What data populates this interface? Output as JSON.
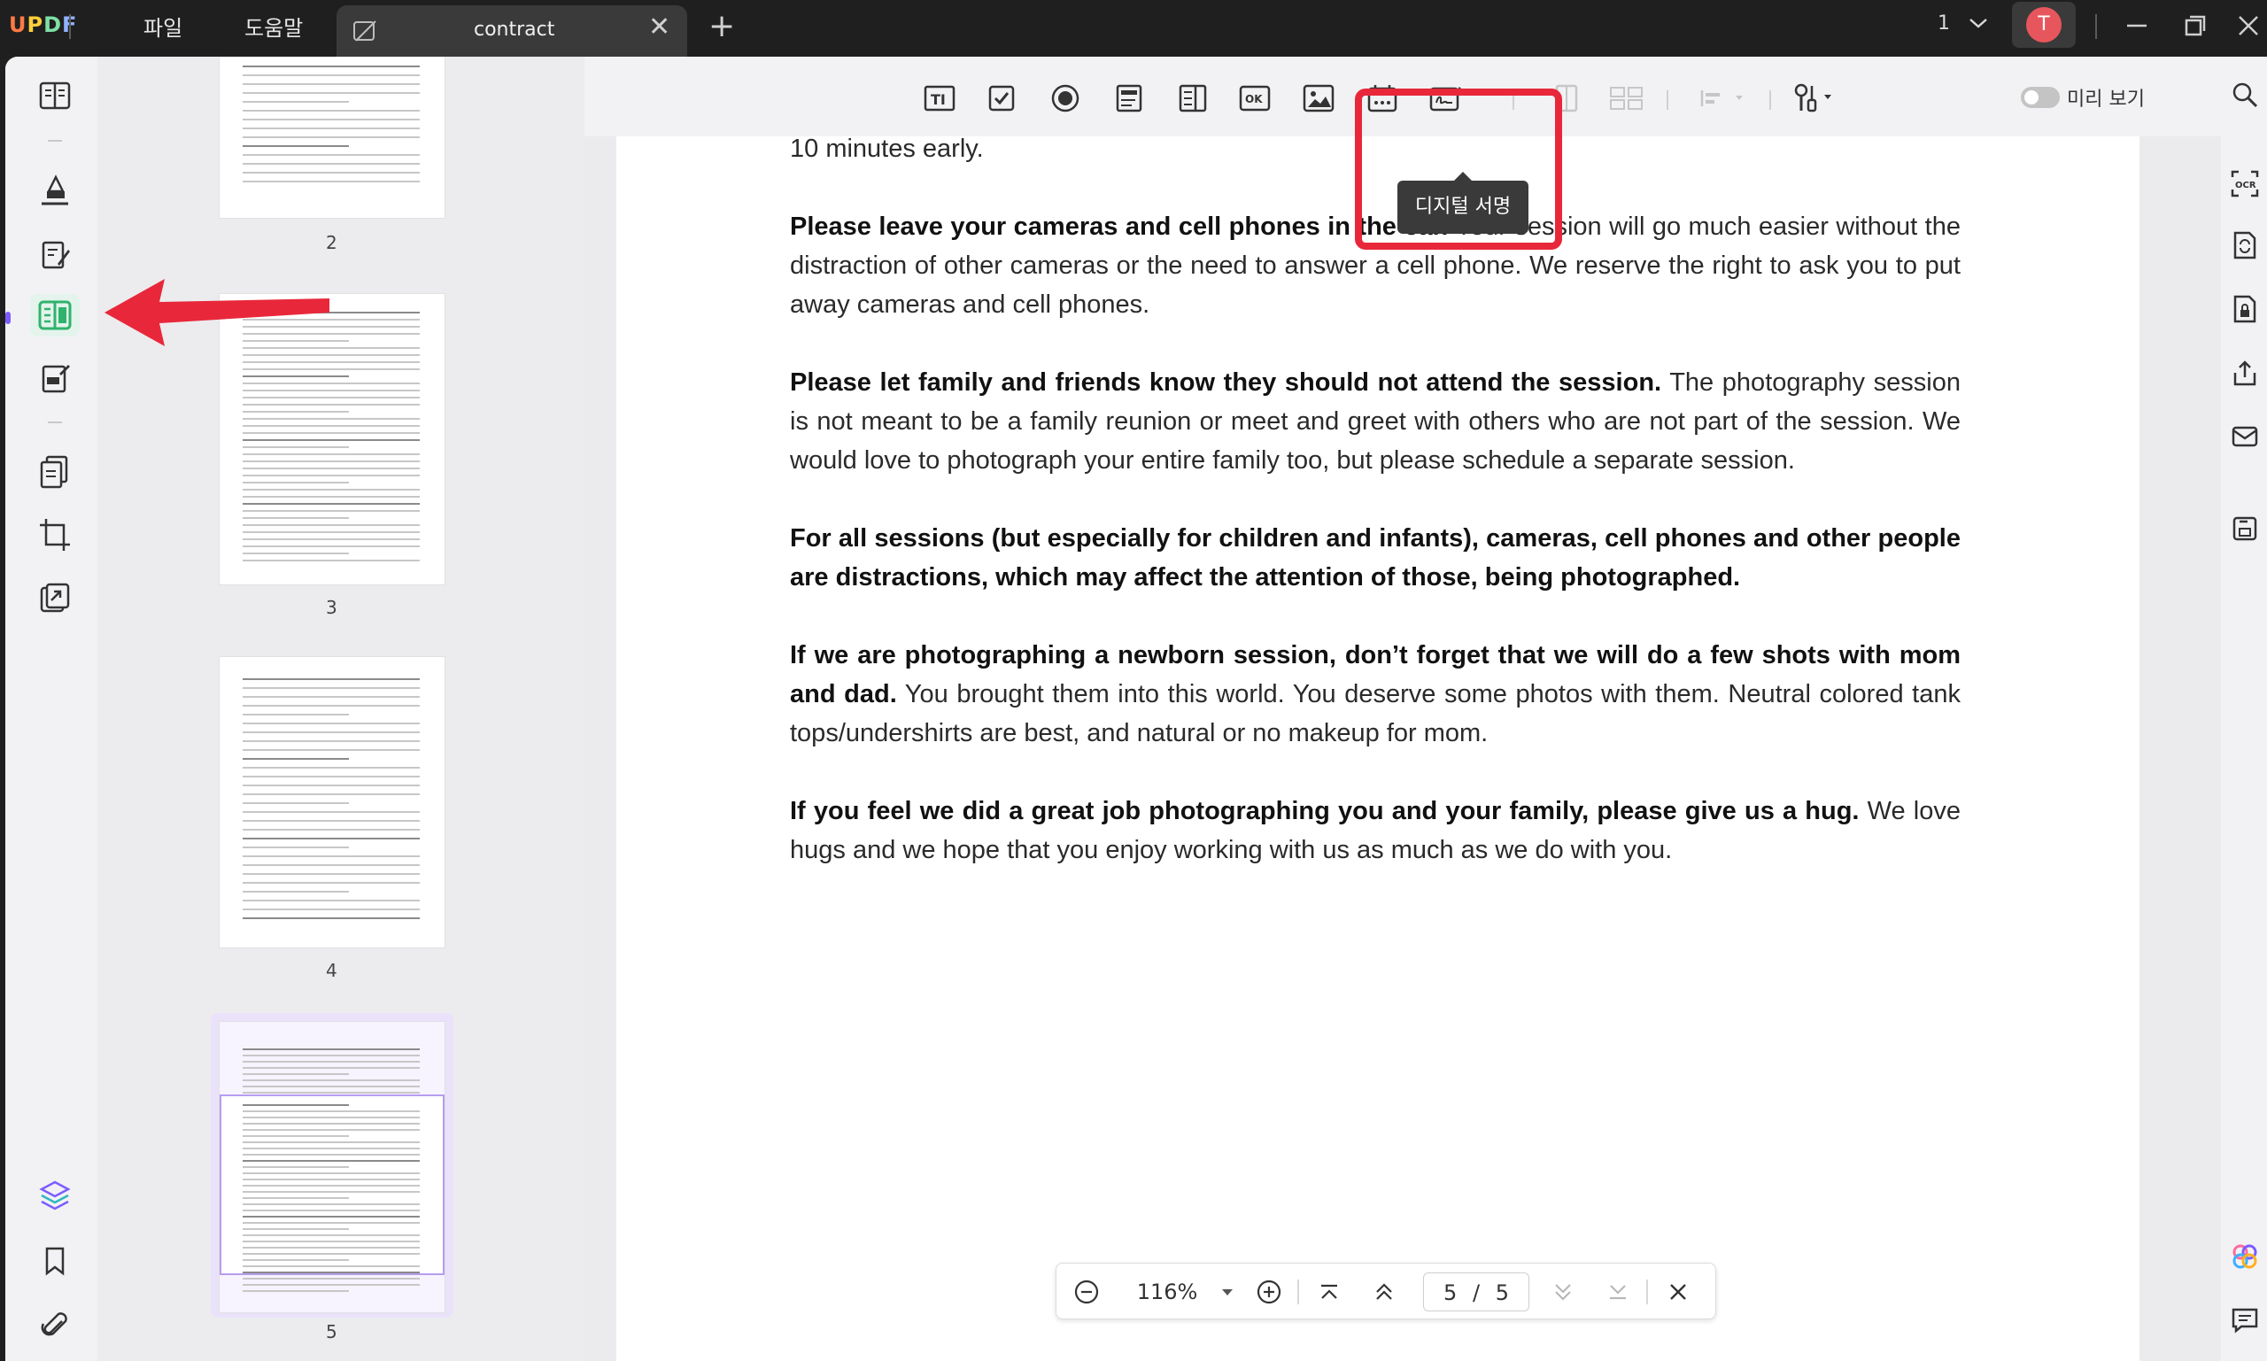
{
  "app": {
    "name": "UPDF"
  },
  "menu": {
    "file": "파일",
    "help": "도움말"
  },
  "tab": {
    "title": "contract",
    "close": "✕",
    "add": "+"
  },
  "window": {
    "page_indicator": "1",
    "avatar_letter": "T"
  },
  "toolbar": {
    "tooltip": "디지털 서명",
    "preview_label": "미리 보기",
    "tools": [
      "text-field-icon",
      "checkbox-icon",
      "radio-button-icon",
      "list-box-icon",
      "dropdown-icon",
      "button-icon",
      "image-field-icon",
      "date-field-icon",
      "digital-signature-icon"
    ]
  },
  "thumbnails": [
    {
      "number": "2"
    },
    {
      "number": "3"
    },
    {
      "number": "4"
    },
    {
      "number": "5"
    }
  ],
  "document": {
    "lead": "10 minutes early.",
    "paragraphs": [
      {
        "bold": "Please leave your cameras and cell phones in the car.",
        "text": " Your session will go much easier without the distraction of other cameras or the need to answer a cell phone. We reserve the right to ask you to put away cameras and cell phones."
      },
      {
        "bold": "Please let family and friends know they should not attend the session.",
        "text": " The photography session is not meant to be a family reunion or meet and greet with others who are not part of the session. We would love to photograph your entire family too, but please schedule a separate session."
      },
      {
        "bold": "For all sessions (but especially for children and infants), cameras, cell phones and other people are distractions, which may affect the attention of those, being photographed.",
        "text": ""
      },
      {
        "bold": "If we are photographing a newborn session, don’t forget that we will do a few shots with mom and dad.",
        "text": " You brought them into this world. You deserve some photos with them. Neutral colored tank tops/undershirts are best, and natural or no makeup for mom."
      },
      {
        "bold": "If you feel we did a great job photographing you and your family, please give us a hug.",
        "text": " We love hugs and we hope that you enjoy working with us as much as we do with you."
      }
    ]
  },
  "zoombar": {
    "zoom": "116%",
    "current_page": "5",
    "total_pages": "5",
    "separator": "/"
  },
  "colors": {
    "accent_green": "#2fb36b",
    "highlight_red": "#e8283a",
    "arrow_red": "#e8283a",
    "selected_thumb": "#eae2fb"
  }
}
